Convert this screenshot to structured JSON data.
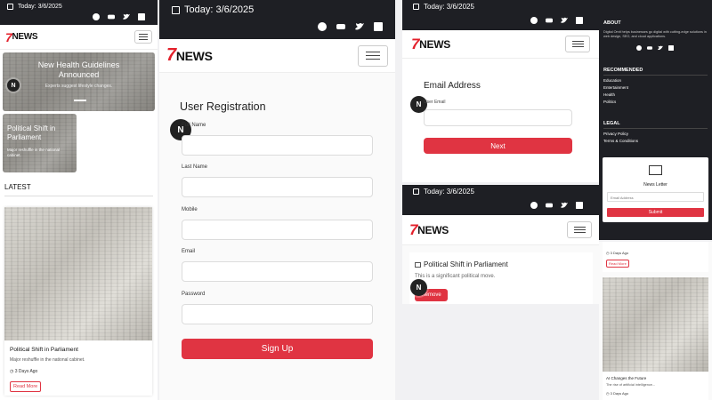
{
  "header": {
    "date_label": "Today: 3/6/2025",
    "logo_text": "NEWS",
    "logo_seven": "7",
    "social_icons": [
      "facebook-icon",
      "youtube-icon",
      "twitter-icon",
      "linkedin-icon"
    ]
  },
  "avatar_letter": "N",
  "home": {
    "hero": {
      "title": "New Health Guidelines Announced",
      "subtitle": "Experts suggest lifestyle changes."
    },
    "second": {
      "title": "Political Shift in Parliament",
      "subtitle": "Major reshuffle in the national cabinet."
    },
    "latest_heading": "LATEST",
    "card": {
      "title": "Political Shift in Parliament",
      "desc": "Major reshuffle in the national cabinet.",
      "time": "3 Days Ago",
      "button": "Read More"
    }
  },
  "registration": {
    "title": "User Registration",
    "fields": [
      {
        "label": "Full Name"
      },
      {
        "label": "Last Name"
      },
      {
        "label": "Mobile"
      },
      {
        "label": "Email"
      },
      {
        "label": "Password"
      }
    ],
    "submit": "Sign Up"
  },
  "email_step": {
    "title": "Email Address",
    "field_label": "User Email",
    "next": "Next"
  },
  "saved": {
    "title": "Political Shift in Parliament",
    "desc": "This is a significant political move.",
    "remove": "Remove"
  },
  "footer": {
    "about_heading": "ABOUT",
    "about_text": "Digital Omit helps businesses go digital with cutting-edge solutions in web design, SEO, and cloud applications.",
    "recommended_heading": "RECOMMENDED",
    "recommended": [
      "Education",
      "Entertainment",
      "Health",
      "Politics"
    ],
    "legal_heading": "LEGAL",
    "legal": [
      "Privacy Policy",
      "Terms & Conditions"
    ],
    "newsletter": {
      "title": "News Letter",
      "placeholder": "Email Address",
      "button": "Submit"
    }
  },
  "right_cards": {
    "top_time": "3 Days Ago",
    "top_button": "Read More",
    "bottom_title": "AI Changes the Future",
    "bottom_desc": "The rise of artificial intelligence...",
    "bottom_time": "3 Days Ago"
  },
  "colors": {
    "accent": "#e03442",
    "dark": "#1e1f24",
    "brand_red": "#e3202b"
  }
}
